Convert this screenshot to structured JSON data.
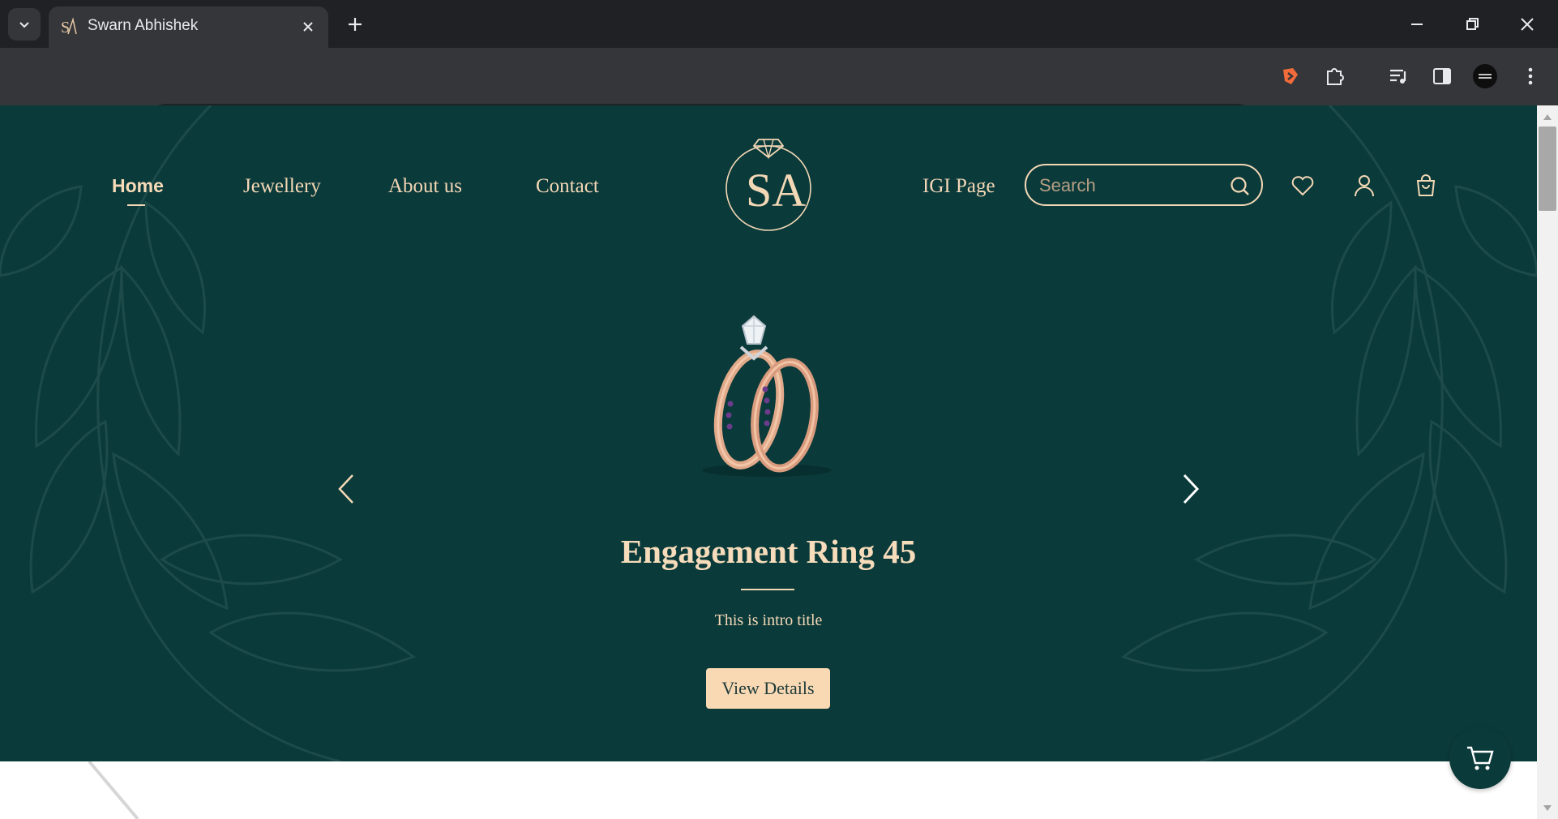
{
  "browser": {
    "tab_title": "Swarn Abhishek",
    "url": "localhost"
  },
  "header": {
    "nav_left": [
      {
        "label": "Home",
        "active": true
      },
      {
        "label": "Jewellery",
        "active": false
      },
      {
        "label": "About us",
        "active": false
      },
      {
        "label": "Contact",
        "active": false
      }
    ],
    "nav_right_link": "IGI Page",
    "logo_text": "SA",
    "search_placeholder": "Search"
  },
  "hero": {
    "title": "Engagement Ring 45",
    "subtitle": "This is intro title",
    "cta_label": "View Details"
  },
  "icons": {
    "wishlist": "heart-icon",
    "account": "user-icon",
    "cart": "shopping-bag-icon",
    "floating_cart": "cart-icon",
    "prev": "chevron-left-icon",
    "next": "chevron-right-icon"
  },
  "colors": {
    "brand_background": "#0b3a3a",
    "brand_gold": "#f3d8b6",
    "cta_background": "#f9d9b3"
  }
}
